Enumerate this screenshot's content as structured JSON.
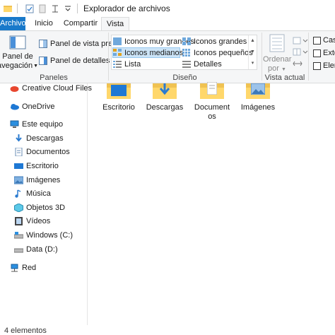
{
  "window": {
    "title": "Explorador de archivos"
  },
  "tabs": {
    "archivo": "Archivo",
    "inicio": "Inicio",
    "compartir": "Compartir",
    "vista": "Vista"
  },
  "ribbon": {
    "paneles": {
      "group_label": "Paneles",
      "nav_pane_line1": "Panel de",
      "nav_pane_line2": "navegación",
      "preview_pane": "Panel de vista previa",
      "details_pane": "Panel de detalles"
    },
    "diseno": {
      "group_label": "Diseño",
      "items": [
        "Iconos muy grandes",
        "Iconos grandes",
        "Iconos medianos",
        "Iconos pequeños",
        "Lista",
        "Detalles"
      ],
      "selected": "Iconos medianos"
    },
    "vista_actual": {
      "group_label": "Vista actual",
      "sort_line1": "Ordenar",
      "sort_line2": "por"
    },
    "show_hide": {
      "checkbox1": "Casi",
      "checkbox2": "Exte",
      "checkbox3": "Elem"
    }
  },
  "nav": {
    "items": [
      {
        "label": "Creative Cloud Files",
        "icon": "creative-cloud-icon"
      },
      {
        "label": "OneDrive",
        "icon": "onedrive-icon"
      },
      {
        "label": "Este equipo",
        "icon": "pc-icon"
      },
      {
        "label": "Descargas",
        "icon": "downloads-icon"
      },
      {
        "label": "Documentos",
        "icon": "documents-icon"
      },
      {
        "label": "Escritorio",
        "icon": "desktop-icon"
      },
      {
        "label": "Imágenes",
        "icon": "pictures-icon"
      },
      {
        "label": "Música",
        "icon": "music-icon"
      },
      {
        "label": "Objetos 3D",
        "icon": "objects3d-icon"
      },
      {
        "label": "Vídeos",
        "icon": "videos-icon"
      },
      {
        "label": "Windows (C:)",
        "icon": "drive-icon"
      },
      {
        "label": "Data (D:)",
        "icon": "drive-icon"
      },
      {
        "label": "Red",
        "icon": "network-icon"
      }
    ]
  },
  "files": [
    {
      "label_line1": "Escritorio",
      "label_line2": ""
    },
    {
      "label_line1": "Descargas",
      "label_line2": ""
    },
    {
      "label_line1": "Document",
      "label_line2": "os"
    },
    {
      "label_line1": "Imágenes",
      "label_line2": ""
    }
  ],
  "status": {
    "count_text": "4 elementos"
  },
  "colors": {
    "accent": "#1979ca",
    "folder": "#ffd76b",
    "selection": "#cce4f7"
  }
}
